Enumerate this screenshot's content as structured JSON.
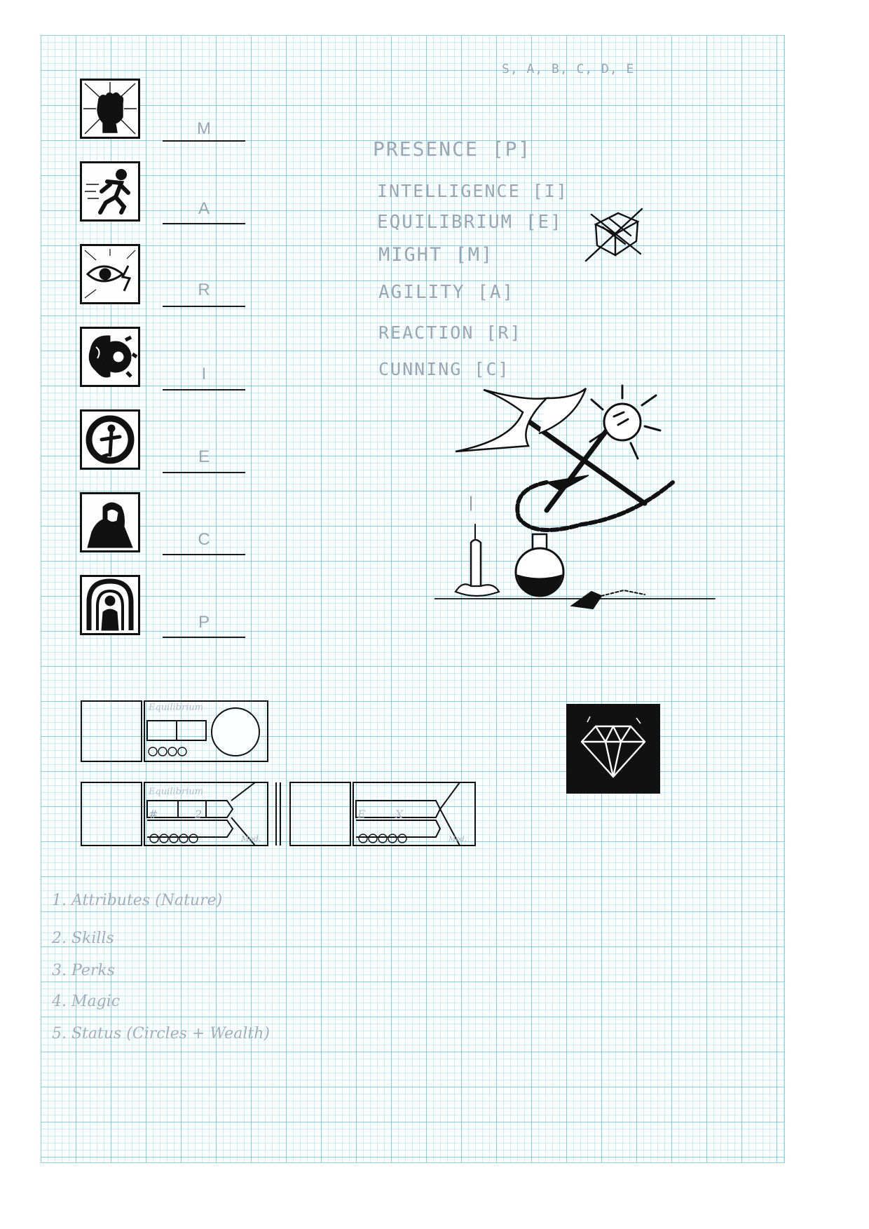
{
  "tier_scale": "S, A, B, C, D, E",
  "attributes_list": [
    "PRESENCE [P]",
    "INTELLIGENCE [I]",
    "EQUILIBRIUM [E]",
    "MIGHT [M]",
    "AGILITY [A]",
    "REACTION [R]",
    "CUNNING [C]"
  ],
  "icon_column": [
    {
      "icon": "fist-icon",
      "letter": "M"
    },
    {
      "icon": "running-man-icon",
      "letter": "A"
    },
    {
      "icon": "eye-lightning-icon",
      "letter": "R"
    },
    {
      "icon": "brain-gear-icon",
      "letter": "I"
    },
    {
      "icon": "balance-figure-icon",
      "letter": "E"
    },
    {
      "icon": "hooded-figure-icon",
      "letter": "C"
    },
    {
      "icon": "aura-figure-icon",
      "letter": "P"
    }
  ],
  "card_sketches": {
    "card1_label": "Equilibrium",
    "card2_label": "Equilibrium",
    "card2_hash": "#",
    "card2_value": "2",
    "card2_mod": "Mod.",
    "card3_left": "E",
    "card3_right": "X",
    "card3_mod": "Mod."
  },
  "sections": [
    "1. Attributes  (Nature)",
    "2. Skills",
    "3. Perks",
    "4. Magic",
    "5. Status  (Circles + Wealth)"
  ],
  "colors": {
    "grid": "#50bed7",
    "ink": "#111111",
    "pencil": "#9aa6b4"
  }
}
